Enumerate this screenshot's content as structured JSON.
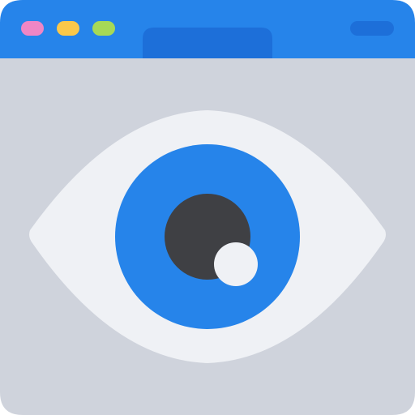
{
  "icon": {
    "name": "browser-window-eye-icon",
    "colors": {
      "window_body": "#cfd3dc",
      "title_bar": "#2684ea",
      "tab": "#1d6fd9",
      "address_pill": "#1d6fd9",
      "dot_close": "#ef86c5",
      "dot_minimize": "#fbc84a",
      "dot_maximize": "#a6d957",
      "eye_white": "#eff1f5",
      "iris": "#2684ea",
      "pupil": "#3f4044",
      "highlight": "#eff1f5"
    }
  }
}
